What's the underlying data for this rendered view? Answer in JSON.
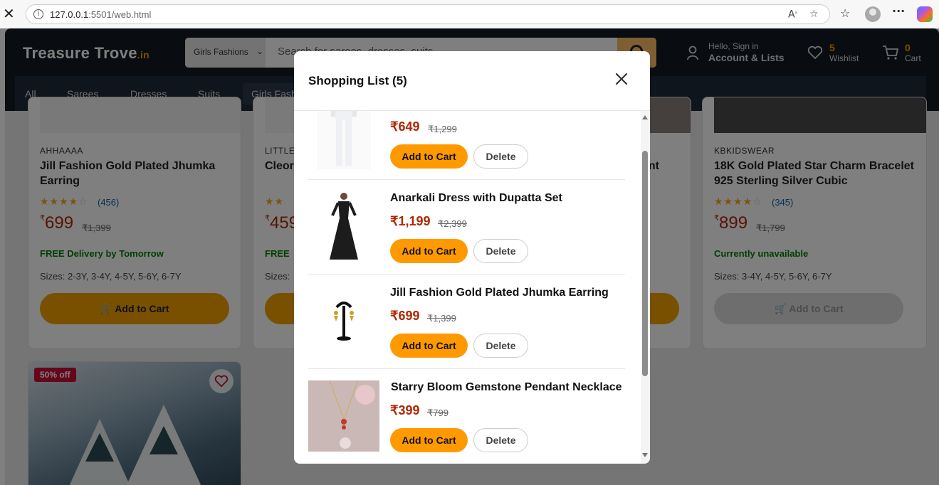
{
  "browser": {
    "url_host": "127.0.0.1",
    "url_rest": ":5501/web.html"
  },
  "site": {
    "logo": "Treasure Trove",
    "logo_suffix": ".in",
    "search_category": "Girls Fashions",
    "search_placeholder": "Search for sarees, dresses, suits...",
    "account_greeting": "Hello, Sign in",
    "account_label": "Account & Lists",
    "wishlist_count": "5",
    "wishlist_label": "Wishlist",
    "cart_count": "0",
    "cart_label": "Cart",
    "nav": [
      "All",
      "Sarees",
      "Dresses",
      "Suits",
      "Girls Fashions"
    ]
  },
  "products": [
    {
      "brand": "AHHAAAA",
      "title": "Jill Fashion Gold Plated Jhumka Earring",
      "stars": "★★★★",
      "stars_empty": "☆",
      "rating_count": "(456)",
      "price": "699",
      "mrp": "₹1,399",
      "delivery": "FREE Delivery by Tomorrow",
      "sizes": "Sizes: 2-3Y, 3-4Y, 4-5Y, 5-6Y, 6-7Y",
      "add_to_cart": "Add to Cart"
    },
    {
      "brand": "LITTLE",
      "title": "Cleor",
      "price": "459",
      "delivery": "FREE",
      "sizes": "Sizes:"
    },
    {
      "title_tail": "ant"
    },
    {
      "brand": "KBKIDSWEAR",
      "title": "18K Gold Plated Star Charm Bracelet 925 Sterling Silver Cubic",
      "stars": "★★★★",
      "stars_empty": "☆",
      "rating_count": "(345)",
      "price": "899",
      "mrp": "₹1,799",
      "delivery": "Currently unavailable",
      "sizes": "Sizes: 3-4Y, 4-5Y, 5-6Y, 6-7Y",
      "add_to_cart": "Add to Cart"
    }
  ],
  "promo_card": {
    "badge": "50% off"
  },
  "modal": {
    "title": "Shopping List (5)",
    "add_to_cart_label": "Add to Cart",
    "delete_label": "Delete",
    "items": [
      {
        "name": "",
        "price": "₹649",
        "mrp": "₹1,299"
      },
      {
        "name": "Anarkali Dress with Dupatta Set",
        "price": "₹1,199",
        "mrp": "₹2,399"
      },
      {
        "name": "Jill Fashion Gold Plated Jhumka Earring",
        "price": "₹699",
        "mrp": "₹1,399"
      },
      {
        "name": "Starry Bloom Gemstone Pendant Necklace",
        "price": "₹399",
        "mrp": "₹799"
      }
    ]
  },
  "colors": {
    "accent": "#ff9900",
    "price": "#b12704",
    "header": "#131a22"
  }
}
